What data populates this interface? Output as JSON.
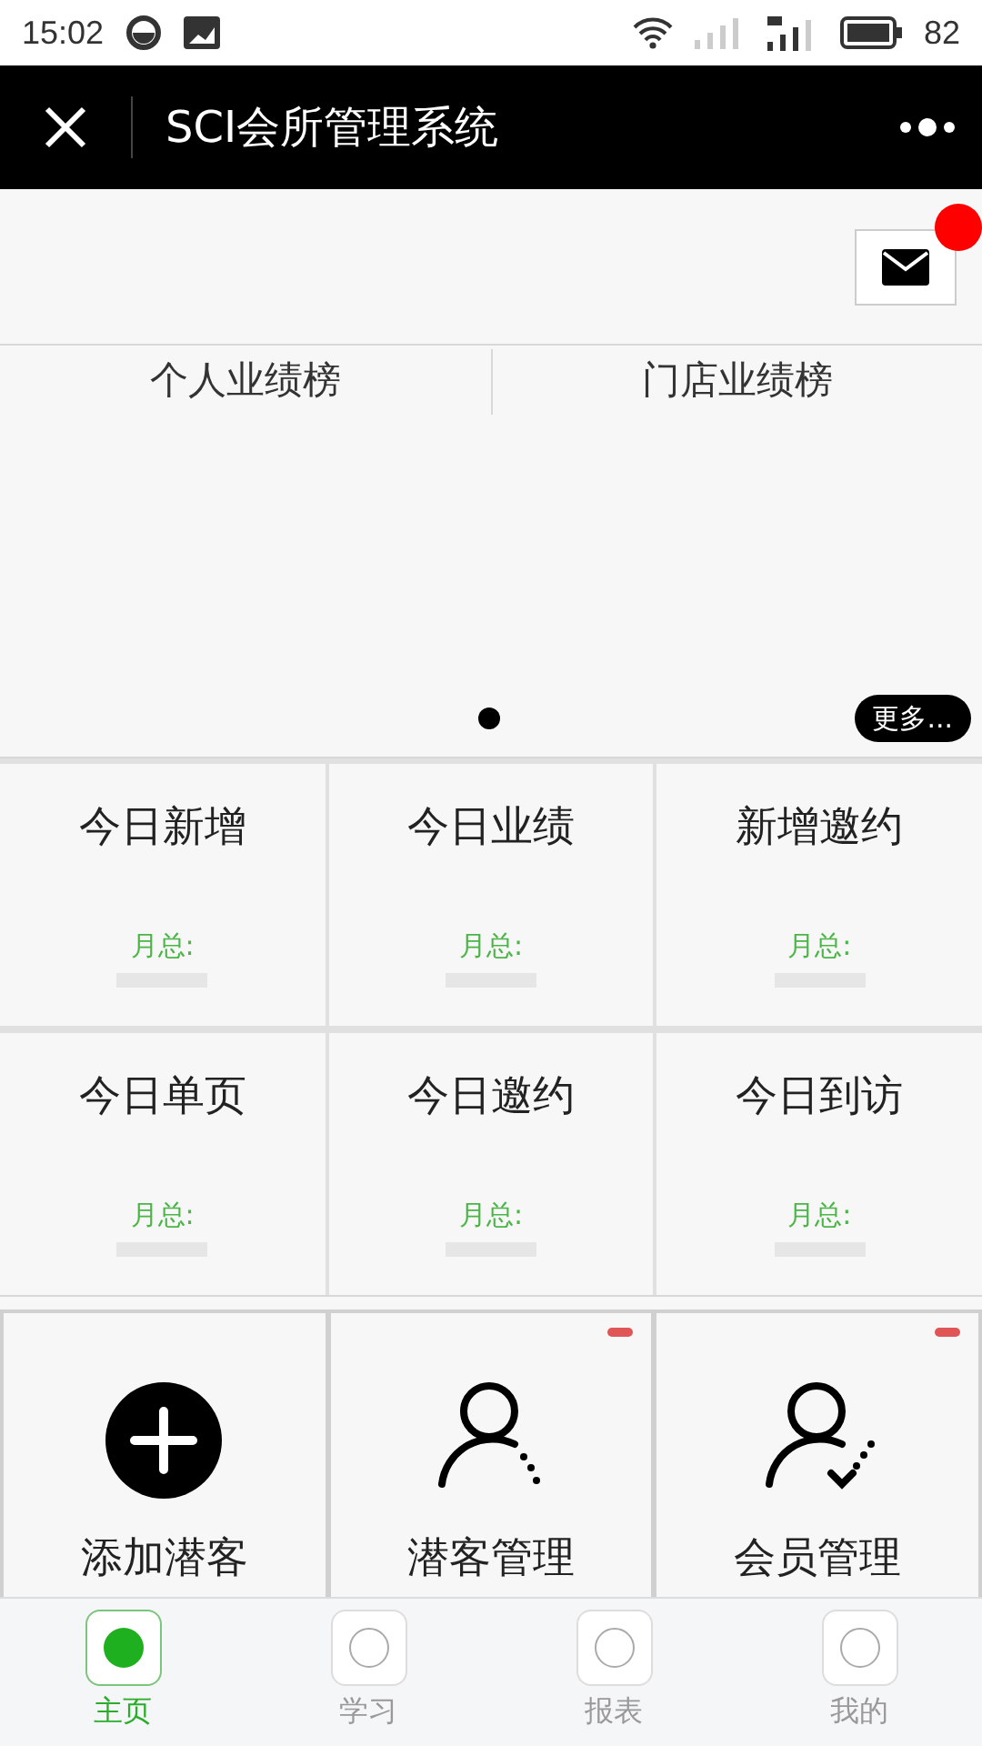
{
  "status_bar": {
    "time": "15:02",
    "battery": "82"
  },
  "header": {
    "title": "SCI会所管理系统"
  },
  "mail": {
    "unread": true
  },
  "rank_tabs": [
    {
      "label": "个人业绩榜"
    },
    {
      "label": "门店业绩榜"
    }
  ],
  "carousel": {
    "more": "更多..."
  },
  "stats": [
    {
      "title": "今日新增",
      "monthly": "月总:"
    },
    {
      "title": "今日业绩",
      "monthly": "月总:"
    },
    {
      "title": "新增邀约",
      "monthly": "月总:"
    },
    {
      "title": "今日单页",
      "monthly": "月总:"
    },
    {
      "title": "今日邀约",
      "monthly": "月总:"
    },
    {
      "title": "今日到访",
      "monthly": "月总:"
    }
  ],
  "actions": [
    {
      "kind": "add",
      "label": "添加潜客",
      "badge": false
    },
    {
      "kind": "prospects",
      "label": "潜客管理",
      "badge": true
    },
    {
      "kind": "members",
      "label": "会员管理",
      "badge": true
    }
  ],
  "tab_bar": [
    {
      "label": "主页",
      "selected": true
    },
    {
      "label": "学习",
      "selected": false
    },
    {
      "label": "报表",
      "selected": false
    },
    {
      "label": "我的",
      "selected": false
    }
  ]
}
